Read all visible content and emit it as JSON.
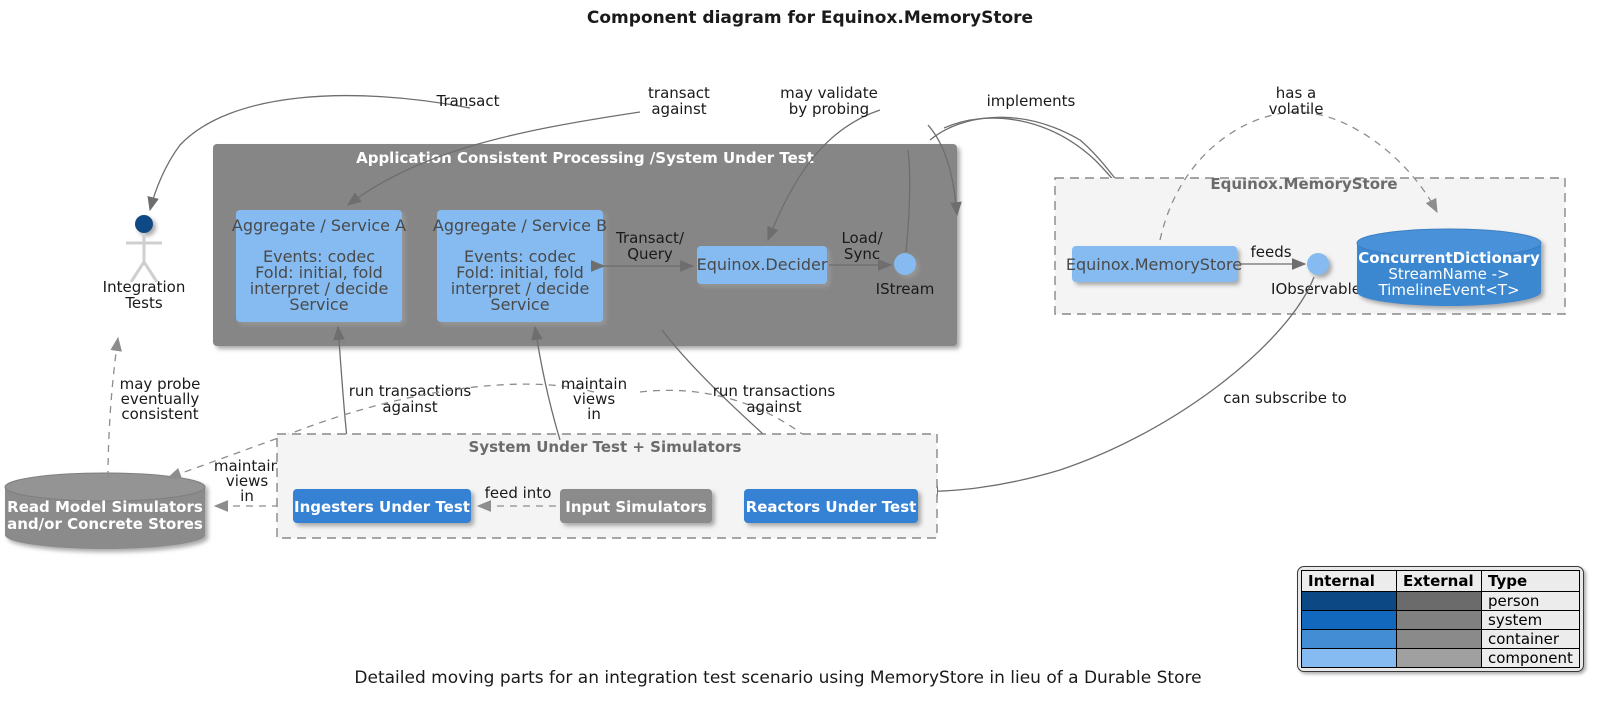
{
  "title": "Component diagram for Equinox.MemoryStore",
  "caption": "Detailed moving parts for an integration test scenario using MemoryStore in lieu of a Durable Store",
  "colors": {
    "person": "#0b4884",
    "system": "#1168bd",
    "container": "#438dd5",
    "component": "#85bbf0",
    "external": "#808080",
    "sut_container": "#888888",
    "package_bg": "#f4f4f4",
    "edge": "#6e6e6e"
  },
  "actors": {
    "integration_tests": {
      "label_line1": "Integration",
      "label_line2": "Tests"
    }
  },
  "packages": {
    "sut": {
      "title": "Application Consistent Processing /System Under Test",
      "components": {
        "aggregate_a": {
          "title": "Aggregate / Service A",
          "lines": [
            "Events: codec",
            "Fold: initial, fold",
            "interpret / decide",
            "Service"
          ]
        },
        "aggregate_b": {
          "title": "Aggregate / Service B",
          "lines": [
            "Events: codec",
            "Fold: initial, fold",
            "interpret / decide",
            "Service"
          ]
        },
        "decider": {
          "title": "Equinox.Decider"
        },
        "istream": {
          "label": "IStream"
        }
      }
    },
    "memorystore": {
      "title": "Equinox.MemoryStore",
      "components": {
        "memorystore_component": {
          "title": "Equinox.MemoryStore"
        },
        "iobservable": {
          "label": "IObservable"
        },
        "concurrent_dictionary": {
          "title": "ConcurrentDictionary",
          "line2": "StreamName ->",
          "line3": "TimelineEvent<T>"
        }
      }
    },
    "sut_simulators": {
      "title": "System Under Test + Simulators",
      "components": {
        "ingesters": {
          "title": "Ingesters Under Test"
        },
        "input_simulators": {
          "title": "Input Simulators"
        },
        "reactors": {
          "title": "Reactors Under Test"
        }
      }
    }
  },
  "stores": {
    "read_model": {
      "line1": "Read Model Simulators",
      "line2": "and/or Concrete Stores"
    }
  },
  "edge_labels": {
    "transact": "Transact",
    "transact_against_1": "transact",
    "transact_against_2": "against",
    "may_validate_1": "may validate",
    "may_validate_2": "by probing",
    "implements": "implements",
    "has_a_1": "has a",
    "has_a_2": "volatile",
    "transact_query_1": "Transact/",
    "transact_query_2": "Query",
    "load_sync_1": "Load/",
    "load_sync_2": "Sync",
    "feeds": "feeds",
    "can_subscribe_to": "can subscribe to",
    "may_probe_1": "may probe",
    "may_probe_2": "eventually",
    "may_probe_3": "consistent",
    "run_transactions_against_l1": "run transactions",
    "run_transactions_against_l2": "against",
    "maintain_views_in_1": "maintain",
    "maintain_views_in_2": "views",
    "maintain_views_in_3": "in",
    "run_transactions_against_r1": "run transactions",
    "run_transactions_against_r2": "against",
    "maintain_views_left_1": "maintain",
    "maintain_views_left_2": "views",
    "maintain_views_left_3": "in",
    "feed_into": "feed into"
  },
  "legend": {
    "headers": [
      "Internal",
      "External",
      "Type"
    ],
    "rows": [
      {
        "internal": "#0b4884",
        "external": "#6b6b6b",
        "type": "person"
      },
      {
        "internal": "#1168bd",
        "external": "#808080",
        "type": "system"
      },
      {
        "internal": "#438dd5",
        "external": "#8a8a8a",
        "type": "container"
      },
      {
        "internal": "#85bbf0",
        "external": "#a0a0a0",
        "type": "component"
      }
    ]
  }
}
